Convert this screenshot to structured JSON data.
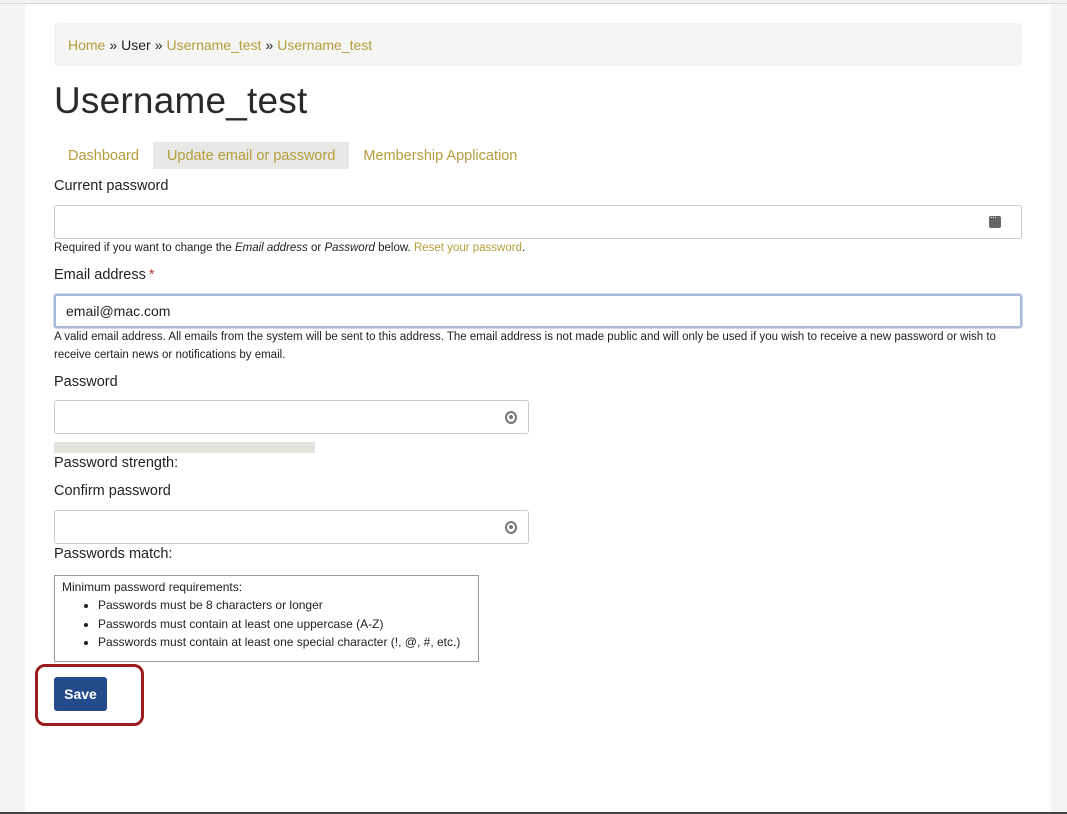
{
  "breadcrumb": {
    "home": "Home",
    "sep": "»",
    "user": "User",
    "item1": "Username_test",
    "item2": "Username_test"
  },
  "page_title": "Username_test",
  "tabs": [
    {
      "label": "Dashboard",
      "active": false
    },
    {
      "label": "Update email or password",
      "active": true
    },
    {
      "label": "Membership Application",
      "active": false
    }
  ],
  "current_password": {
    "label": "Current password",
    "value": "",
    "help_prefix": "Required if you want to change the ",
    "help_em1": "Email address",
    "help_mid": " or ",
    "help_em2": "Password",
    "help_suffix": " below. ",
    "help_link": "Reset your password",
    "help_end": "."
  },
  "email": {
    "label": "Email address",
    "required_mark": "*",
    "value": "email@mac.com",
    "help": "A valid email address. All emails from the system will be sent to this address. The email address is not made public and will only be used if you wish to receive a new password or wish to receive certain news or notifications by email."
  },
  "password": {
    "label": "Password",
    "value": "",
    "strength_label": "Password strength:"
  },
  "confirm_password": {
    "label": "Confirm password",
    "value": "",
    "match_label": "Passwords match:"
  },
  "requirements": {
    "title": "Minimum password requirements:",
    "items": [
      "Passwords must be 8 characters or longer",
      "Passwords must contain at least one uppercase (A-Z)",
      "Passwords must contain at least one special character (!, @, #, etc.)"
    ]
  },
  "save_label": "Save",
  "colors": {
    "link": "#b69d3a",
    "button": "#234b8c",
    "highlight": "#9b1c1c",
    "required": "#c0392b"
  }
}
